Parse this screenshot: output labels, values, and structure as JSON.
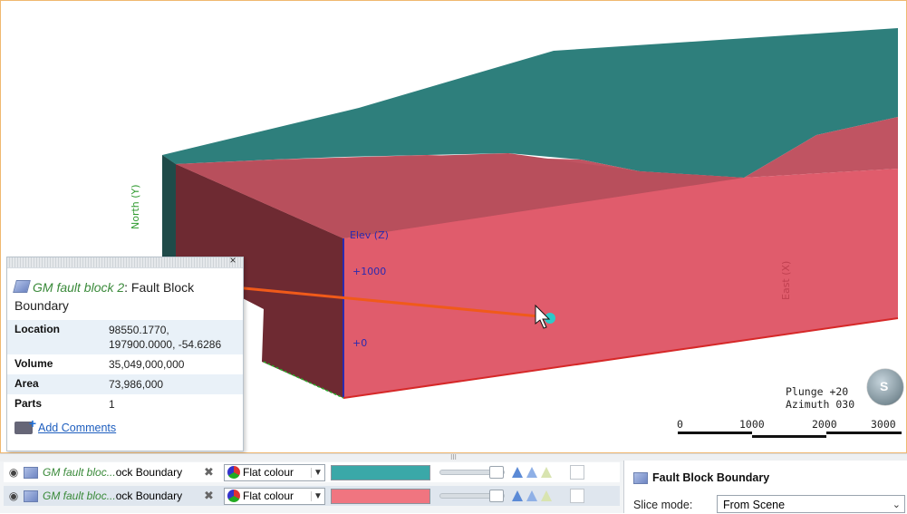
{
  "viewport": {
    "axis_labels": {
      "elev": "Elev (Z)",
      "elev_1000": "+1000",
      "elev_0": "+0",
      "north": "North (Y)",
      "east": "East (X)"
    },
    "orientation": {
      "plunge": "Plunge +20",
      "azimuth": "Azimuth 030"
    },
    "compass_letter": "S",
    "scale": [
      "0",
      "1000",
      "2000",
      "3000"
    ],
    "colors": {
      "top_face": "#2e7f7c",
      "front_face": "#e05c6c",
      "left_face": "#6e2a32",
      "arrow": "#f05a1a",
      "pointer": "#2ec9c9"
    }
  },
  "popup": {
    "object_name": "GM fault block 2",
    "object_type": ": Fault Block Boundary",
    "close": "×",
    "rows": [
      {
        "key": "Location",
        "value": "98550.1770, 197900.0000, -54.6286"
      },
      {
        "key": "Volume",
        "value": "35,049,000,000"
      },
      {
        "key": "Area",
        "value": "73,986,000"
      },
      {
        "key": "Parts",
        "value": "1"
      }
    ],
    "add_comments": "Add Comments"
  },
  "bottom": {
    "splitter": "III",
    "rows": [
      {
        "name_green": "GM fault bloc...",
        "name_rest": "ock Boundary",
        "mode": "Flat colour",
        "color": "#3aa8a8"
      },
      {
        "name_green": "GM fault bloc...",
        "name_rest": "ock Boundary",
        "mode": "Flat colour",
        "color": "#f07580"
      }
    ],
    "properties": {
      "title": "Fault Block Boundary",
      "slice_label": "Slice mode:",
      "slice_value": "From Scene"
    }
  }
}
